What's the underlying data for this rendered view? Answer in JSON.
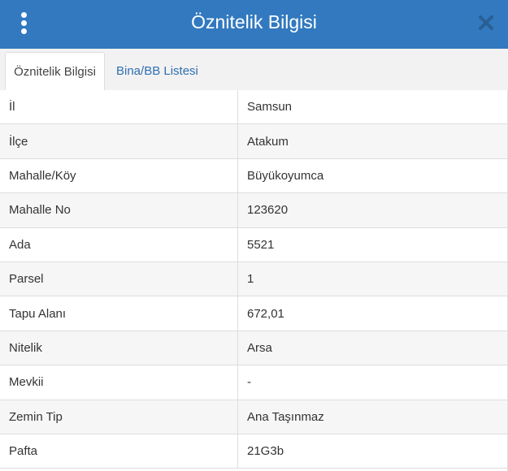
{
  "header": {
    "title": "Öznitelik Bilgisi",
    "background_color": "#3279bf",
    "menu_icon": "vertical-dots-icon",
    "close_icon": "close-icon"
  },
  "tabs": [
    {
      "label": "Öznitelik Bilgisi",
      "active": true
    },
    {
      "label": "Bina/BB Listesi",
      "active": false
    }
  ],
  "rows": [
    {
      "key": "İl",
      "value": "Samsun"
    },
    {
      "key": "İlçe",
      "value": "Atakum"
    },
    {
      "key": "Mahalle/Köy",
      "value": "Büyükoyumca"
    },
    {
      "key": "Mahalle No",
      "value": "123620"
    },
    {
      "key": "Ada",
      "value": "5521"
    },
    {
      "key": "Parsel",
      "value": "1"
    },
    {
      "key": "Tapu Alanı",
      "value": "672,01"
    },
    {
      "key": "Nitelik",
      "value": "Arsa"
    },
    {
      "key": "Mevkii",
      "value": "-"
    },
    {
      "key": "Zemin Tip",
      "value": "Ana Taşınmaz"
    },
    {
      "key": "Pafta",
      "value": "21G3b"
    }
  ]
}
